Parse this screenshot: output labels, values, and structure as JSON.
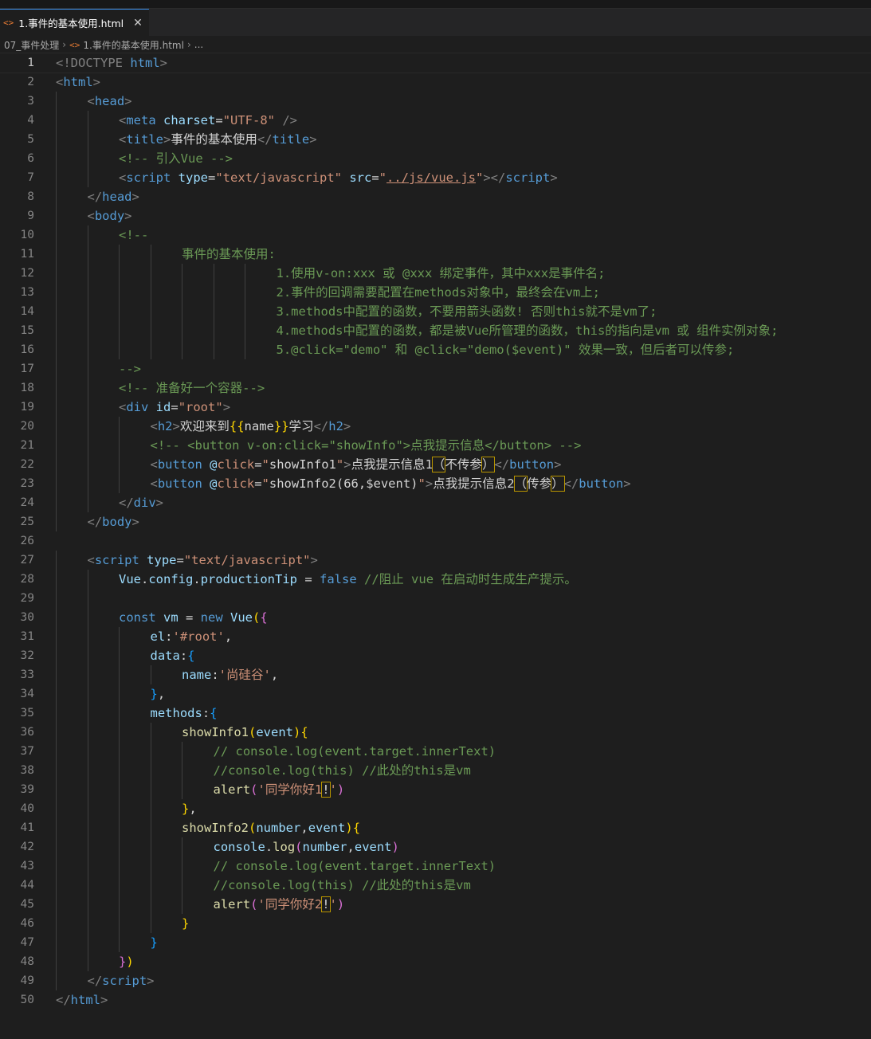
{
  "tab": {
    "icon": "html-file-icon",
    "label": "1.事件的基本使用.html",
    "close": "✕"
  },
  "breadcrumb": [
    "07_事件处理",
    "1.事件的基本使用.html",
    "..."
  ],
  "current_line": 1,
  "lines": [
    [
      1,
      0,
      [
        [
          "p",
          "<!DOCTYPE "
        ],
        [
          "t",
          "html"
        ],
        [
          "p",
          ">"
        ]
      ]
    ],
    [
      2,
      0,
      [
        [
          "p",
          "<"
        ],
        [
          "t",
          "html"
        ],
        [
          "p",
          ">"
        ]
      ]
    ],
    [
      3,
      1,
      [
        [
          "p",
          "<"
        ],
        [
          "t",
          "head"
        ],
        [
          "p",
          ">"
        ]
      ]
    ],
    [
      4,
      2,
      [
        [
          "p",
          "<"
        ],
        [
          "t",
          "meta "
        ],
        [
          "a",
          "charset"
        ],
        [
          "x",
          "="
        ],
        [
          "s",
          "\"UTF-8\""
        ],
        [
          "p",
          " />"
        ]
      ]
    ],
    [
      5,
      2,
      [
        [
          "p",
          "<"
        ],
        [
          "t",
          "title"
        ],
        [
          "p",
          ">"
        ],
        [
          "x",
          "事件的基本使用"
        ],
        [
          "p",
          "</"
        ],
        [
          "t",
          "title"
        ],
        [
          "p",
          ">"
        ]
      ]
    ],
    [
      6,
      2,
      [
        [
          "c",
          "<!-- 引入Vue -->"
        ]
      ]
    ],
    [
      7,
      2,
      [
        [
          "p",
          "<"
        ],
        [
          "t",
          "script "
        ],
        [
          "a",
          "type"
        ],
        [
          "x",
          "="
        ],
        [
          "s",
          "\"text/javascript\" "
        ],
        [
          "a",
          "src"
        ],
        [
          "x",
          "="
        ],
        [
          "s",
          "\""
        ],
        [
          "u",
          "../js/vue.js"
        ],
        [
          "s",
          "\""
        ],
        [
          "p",
          "></"
        ],
        [
          "t",
          "script"
        ],
        [
          "p",
          ">"
        ]
      ]
    ],
    [
      8,
      1,
      [
        [
          "p",
          "</"
        ],
        [
          "t",
          "head"
        ],
        [
          "p",
          ">"
        ]
      ]
    ],
    [
      9,
      1,
      [
        [
          "p",
          "<"
        ],
        [
          "t",
          "body"
        ],
        [
          "p",
          ">"
        ]
      ]
    ],
    [
      10,
      2,
      [
        [
          "c",
          "<!--"
        ]
      ]
    ],
    [
      11,
      4,
      [
        [
          "c",
          "事件的基本使用:"
        ]
      ]
    ],
    [
      12,
      7,
      [
        [
          "c",
          "1.使用v-on:xxx 或 @xxx 绑定事件，其中xxx是事件名;"
        ]
      ]
    ],
    [
      13,
      7,
      [
        [
          "c",
          "2.事件的回调需要配置在methods对象中，最终会在vm上;"
        ]
      ]
    ],
    [
      14,
      7,
      [
        [
          "c",
          "3.methods中配置的函数，不要用箭头函数! 否则this就不是vm了;"
        ]
      ]
    ],
    [
      15,
      7,
      [
        [
          "c",
          "4.methods中配置的函数，都是被Vue所管理的函数，this的指向是vm 或 组件实例对象;"
        ]
      ]
    ],
    [
      16,
      7,
      [
        [
          "c",
          "5.@click=\"demo\" 和 @click=\"demo($event)\" 效果一致，但后者可以传参;"
        ]
      ]
    ],
    [
      17,
      2,
      [
        [
          "c",
          "-->"
        ]
      ]
    ],
    [
      18,
      2,
      [
        [
          "c",
          "<!-- 准备好一个容器-->"
        ]
      ]
    ],
    [
      19,
      2,
      [
        [
          "p",
          "<"
        ],
        [
          "t",
          "div "
        ],
        [
          "a",
          "id"
        ],
        [
          "x",
          "="
        ],
        [
          "s",
          "\"root\""
        ],
        [
          "p",
          ">"
        ]
      ]
    ],
    [
      20,
      3,
      [
        [
          "p",
          "<"
        ],
        [
          "t",
          "h2"
        ],
        [
          "p",
          ">"
        ],
        [
          "x",
          "欢迎来到"
        ],
        [
          "y",
          "{{"
        ],
        [
          "x",
          "name"
        ],
        [
          "y",
          "}}"
        ],
        [
          "x",
          "学习"
        ],
        [
          "p",
          "</"
        ],
        [
          "t",
          "h2"
        ],
        [
          "p",
          ">"
        ]
      ]
    ],
    [
      21,
      3,
      [
        [
          "c",
          "<!-- <button v-on:click=\"showInfo\">点我提示信息</button> -->"
        ]
      ]
    ],
    [
      22,
      3,
      [
        [
          "p",
          "<"
        ],
        [
          "t",
          "button "
        ],
        [
          "a",
          "@"
        ],
        [
          "o",
          "click"
        ],
        [
          "x",
          "="
        ],
        [
          "s",
          "\""
        ],
        [
          "x",
          "showInfo1"
        ],
        [
          "s",
          "\""
        ],
        [
          "p",
          ">"
        ],
        [
          "x",
          "点我提示信息1"
        ],
        [
          "h",
          "（"
        ],
        [
          "x",
          "不传参"
        ],
        [
          "h",
          "）"
        ],
        [
          "p",
          "</"
        ],
        [
          "t",
          "button"
        ],
        [
          "p",
          ">"
        ]
      ]
    ],
    [
      23,
      3,
      [
        [
          "p",
          "<"
        ],
        [
          "t",
          "button "
        ],
        [
          "a",
          "@"
        ],
        [
          "o",
          "click"
        ],
        [
          "x",
          "="
        ],
        [
          "s",
          "\""
        ],
        [
          "x",
          "showInfo2(66,$event)"
        ],
        [
          "s",
          "\""
        ],
        [
          "p",
          ">"
        ],
        [
          "x",
          "点我提示信息2"
        ],
        [
          "h",
          "（"
        ],
        [
          "x",
          "传参"
        ],
        [
          "h",
          "）"
        ],
        [
          "p",
          "</"
        ],
        [
          "t",
          "button"
        ],
        [
          "p",
          ">"
        ]
      ]
    ],
    [
      24,
      2,
      [
        [
          "p",
          "</"
        ],
        [
          "t",
          "div"
        ],
        [
          "p",
          ">"
        ]
      ]
    ],
    [
      25,
      1,
      [
        [
          "p",
          "</"
        ],
        [
          "t",
          "body"
        ],
        [
          "p",
          ">"
        ]
      ]
    ],
    [
      26,
      0,
      []
    ],
    [
      27,
      1,
      [
        [
          "p",
          "<"
        ],
        [
          "t",
          "script "
        ],
        [
          "a",
          "type"
        ],
        [
          "x",
          "="
        ],
        [
          "s",
          "\"text/javascript\""
        ],
        [
          "p",
          ">"
        ]
      ]
    ],
    [
      28,
      2,
      [
        [
          "a",
          "Vue"
        ],
        [
          "x",
          "."
        ],
        [
          "a",
          "config"
        ],
        [
          "x",
          "."
        ],
        [
          "a",
          "productionTip"
        ],
        [
          "x",
          " = "
        ],
        [
          "k",
          "false"
        ],
        [
          "x",
          " "
        ],
        [
          "c",
          "//阻止 vue 在启动时生成生产提示。"
        ]
      ]
    ],
    [
      29,
      2,
      []
    ],
    [
      30,
      2,
      [
        [
          "k",
          "const "
        ],
        [
          "a",
          "vm"
        ],
        [
          "x",
          " = "
        ],
        [
          "k",
          "new "
        ],
        [
          "a",
          "Vue"
        ],
        [
          "y",
          "("
        ],
        [
          "m",
          "{"
        ]
      ]
    ],
    [
      31,
      3,
      [
        [
          "a",
          "el"
        ],
        [
          "x",
          ":"
        ],
        [
          "s",
          "'#root'"
        ],
        [
          "x",
          ","
        ]
      ]
    ],
    [
      32,
      3,
      [
        [
          "a",
          "data"
        ],
        [
          "x",
          ":"
        ],
        [
          "b",
          "{"
        ]
      ]
    ],
    [
      33,
      4,
      [
        [
          "a",
          "name"
        ],
        [
          "x",
          ":"
        ],
        [
          "s",
          "'尚硅谷'"
        ],
        [
          "x",
          ","
        ]
      ]
    ],
    [
      34,
      3,
      [
        [
          "b",
          "}"
        ],
        [
          "x",
          ","
        ]
      ]
    ],
    [
      35,
      3,
      [
        [
          "a",
          "methods"
        ],
        [
          "x",
          ":"
        ],
        [
          "b",
          "{"
        ]
      ]
    ],
    [
      36,
      4,
      [
        [
          "f",
          "showInfo1"
        ],
        [
          "y",
          "("
        ],
        [
          "a",
          "event"
        ],
        [
          "y",
          ")"
        ],
        [
          "y",
          "{"
        ]
      ]
    ],
    [
      37,
      5,
      [
        [
          "c",
          "// console.log(event.target.innerText)"
        ]
      ]
    ],
    [
      38,
      5,
      [
        [
          "c",
          "//console.log(this) //此处的this是vm"
        ]
      ]
    ],
    [
      39,
      5,
      [
        [
          "f",
          "alert"
        ],
        [
          "m",
          "("
        ],
        [
          "s",
          "'同学你好1"
        ],
        [
          "h",
          "!"
        ],
        [
          "s",
          "'"
        ],
        [
          "m",
          ")"
        ]
      ]
    ],
    [
      40,
      4,
      [
        [
          "y",
          "}"
        ],
        [
          "x",
          ","
        ]
      ]
    ],
    [
      41,
      4,
      [
        [
          "f",
          "showInfo2"
        ],
        [
          "y",
          "("
        ],
        [
          "a",
          "number"
        ],
        [
          "x",
          ","
        ],
        [
          "a",
          "event"
        ],
        [
          "y",
          ")"
        ],
        [
          "y",
          "{"
        ]
      ]
    ],
    [
      42,
      5,
      [
        [
          "a",
          "console"
        ],
        [
          "x",
          "."
        ],
        [
          "f",
          "log"
        ],
        [
          "m",
          "("
        ],
        [
          "a",
          "number"
        ],
        [
          "x",
          ","
        ],
        [
          "a",
          "event"
        ],
        [
          "m",
          ")"
        ]
      ]
    ],
    [
      43,
      5,
      [
        [
          "c",
          "// console.log(event.target.innerText)"
        ]
      ]
    ],
    [
      44,
      5,
      [
        [
          "c",
          "//console.log(this) //此处的this是vm"
        ]
      ]
    ],
    [
      45,
      5,
      [
        [
          "f",
          "alert"
        ],
        [
          "m",
          "("
        ],
        [
          "s",
          "'同学你好2"
        ],
        [
          "h",
          "!"
        ],
        [
          "s",
          "'"
        ],
        [
          "m",
          ")"
        ]
      ]
    ],
    [
      46,
      4,
      [
        [
          "y",
          "}"
        ]
      ]
    ],
    [
      47,
      3,
      [
        [
          "b",
          "}"
        ]
      ]
    ],
    [
      48,
      2,
      [
        [
          "m",
          "}"
        ],
        [
          "y",
          ")"
        ]
      ]
    ],
    [
      49,
      1,
      [
        [
          "p",
          "</"
        ],
        [
          "t",
          "script"
        ],
        [
          "p",
          ">"
        ]
      ]
    ],
    [
      50,
      0,
      [
        [
          "p",
          "</"
        ],
        [
          "t",
          "html"
        ],
        [
          "p",
          ">"
        ]
      ]
    ]
  ]
}
